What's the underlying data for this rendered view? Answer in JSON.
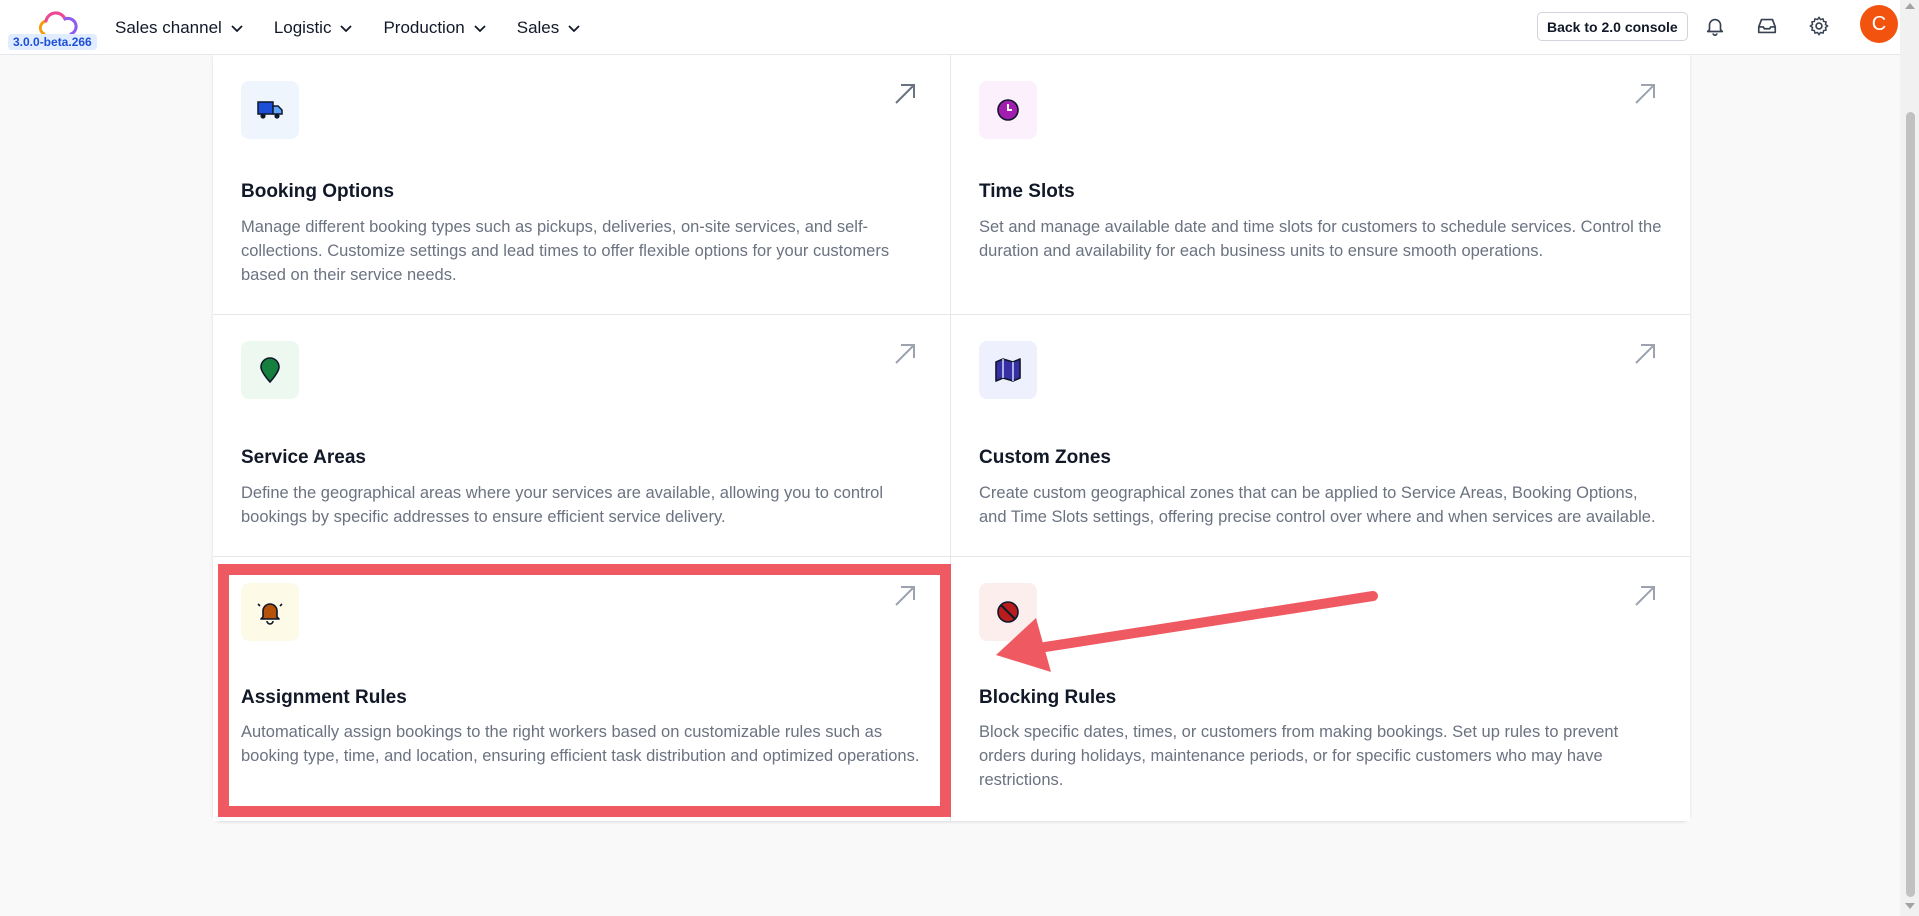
{
  "app": {
    "version": "3.0.0-beta.266",
    "back_button": "Back to 2.0 console",
    "avatar_initial": "C"
  },
  "nav": {
    "items": [
      {
        "label": "Sales channel"
      },
      {
        "label": "Logistic"
      },
      {
        "label": "Production"
      },
      {
        "label": "Sales"
      }
    ]
  },
  "cards": [
    {
      "title": "Booking Options",
      "description": "Manage different booking types such as pickups, deliveries, on-site services, and self-collections. Customize settings and lead times to offer flexible options for your customers based on their service needs.",
      "icon": "truck-icon",
      "icon_bg": "#eef5fd"
    },
    {
      "title": "Time Slots",
      "description": "Set and manage available date and time slots for customers to schedule services. Control the duration and availability for each business units to ensure smooth operations.",
      "icon": "clock-icon",
      "icon_bg": "#fcf0fd"
    },
    {
      "title": "Service Areas",
      "description": "Define the geographical areas where your services are available, allowing you to control bookings by specific addresses to ensure efficient service delivery.",
      "icon": "map-pin-icon",
      "icon_bg": "#edf9f0"
    },
    {
      "title": "Custom Zones",
      "description": "Create custom geographical zones that can be applied to Service Areas, Booking Options, and Time Slots settings, offering precise control over where and when services are available.",
      "icon": "map-icon",
      "icon_bg": "#eef0fd"
    },
    {
      "title": "Assignment Rules",
      "description": "Automatically assign bookings to the right workers based on customizable rules such as booking type, time, and location, ensuring efficient task distribution and optimized operations.",
      "icon": "bell-icon",
      "icon_bg": "#fefae8"
    },
    {
      "title": "Blocking Rules",
      "description": "Block specific dates, times, or customers from making bookings. Set up rules to prevent orders during holidays, maintenance periods, or for specific customers who may have restrictions.",
      "icon": "block-icon",
      "icon_bg": "#fdeeee"
    }
  ],
  "colors": {
    "annotation": "#ef5a62",
    "avatar": "#f2540f",
    "version_badge": "#e0ecff"
  }
}
